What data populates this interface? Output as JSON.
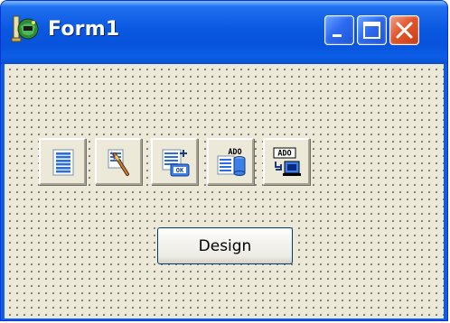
{
  "window": {
    "title": "Form1",
    "icon": "delphi-helmet-icon",
    "caption_buttons": [
      "minimize-icon",
      "maximize-icon",
      "close-icon"
    ]
  },
  "toolbar": {
    "buttons": [
      {
        "icon": "list-page-icon"
      },
      {
        "icon": "magic-wand-icon"
      },
      {
        "icon": "list-ok-icon"
      },
      {
        "icon": "ado-dataset-icon",
        "icon_text": "ADO"
      },
      {
        "icon": "ado-connection-icon",
        "icon_text": "ADO"
      }
    ]
  },
  "design_button": {
    "label": "Design"
  },
  "colors": {
    "titlebar": "#0a58e0",
    "client": "#ece9d8",
    "close": "#e2572e"
  }
}
